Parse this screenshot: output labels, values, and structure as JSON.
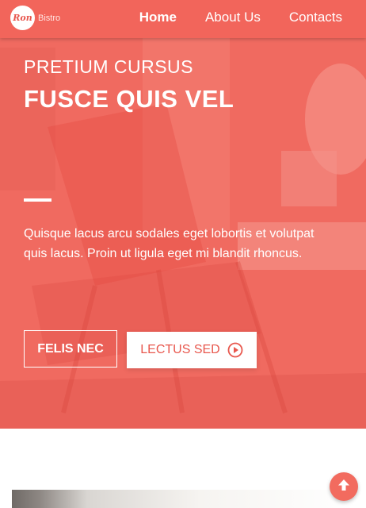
{
  "nav": {
    "logo_mark": "Ron",
    "brand": "Bistro",
    "items": [
      {
        "label": "Home",
        "active": true
      },
      {
        "label": "About Us",
        "active": false
      },
      {
        "label": "Contacts",
        "active": false
      }
    ]
  },
  "hero": {
    "kicker": "PRETIUM CURSUS",
    "title": "FUSCE QUIS VEL",
    "text": "Quisque lacus arcu sodales eget lobortis et volutpat quis lacus. Proin ut ligula eget mi blandit rhoncus.",
    "primary_button": "FELIS NEC",
    "secondary_button": "LECTUS SED",
    "secondary_icon": "play-circle-icon"
  },
  "scroll_top": {
    "icon": "arrow-up-icon"
  },
  "colors": {
    "accent": "#f2655b",
    "overlay": "#ef6a60",
    "button_text": "#e8574d",
    "white": "#ffffff"
  }
}
